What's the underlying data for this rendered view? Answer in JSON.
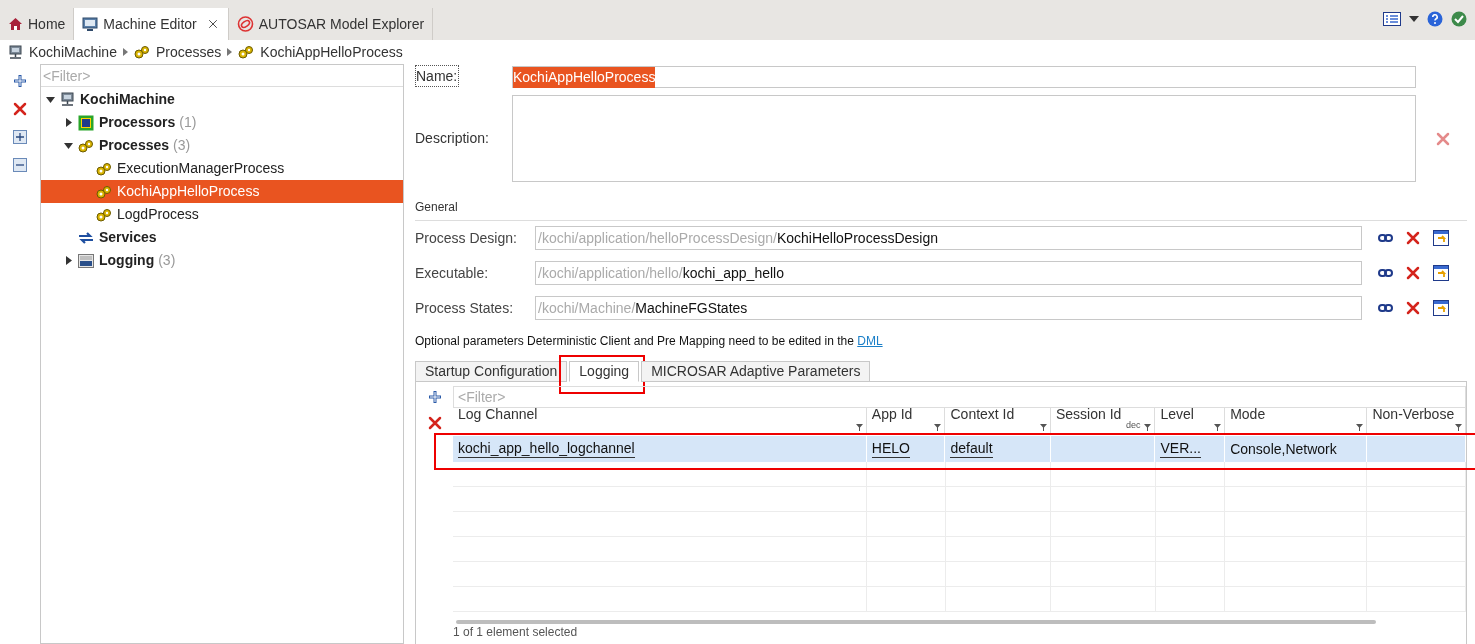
{
  "tabs": [
    {
      "label": "Home",
      "kind": "home",
      "selected": false,
      "closable": false
    },
    {
      "label": "Machine Editor",
      "kind": "editor",
      "selected": true,
      "closable": true
    },
    {
      "label": "AUTOSAR Model Explorer",
      "kind": "explorer",
      "selected": false,
      "closable": false
    }
  ],
  "breadcrumb": [
    {
      "label": "KochiMachine",
      "kind": "machine"
    },
    {
      "label": "Processes",
      "kind": "gears"
    },
    {
      "label": "KochiAppHelloProcess",
      "kind": "gears"
    }
  ],
  "tree": {
    "filter_placeholder": "<Filter>",
    "items": [
      {
        "label": "KochiMachine",
        "kind": "machine",
        "expanded": true,
        "selected": false,
        "children": [
          {
            "label": "Processors",
            "count": "(1)",
            "kind": "chip",
            "expanded": false,
            "selected": false
          },
          {
            "label": "Processes",
            "count": "(3)",
            "kind": "gears",
            "expanded": true,
            "selected": false,
            "children": [
              {
                "label": "ExecutionManagerProcess",
                "kind": "gears",
                "selected": false
              },
              {
                "label": "KochiAppHelloProcess",
                "kind": "gears",
                "selected": true
              },
              {
                "label": "LogdProcess",
                "kind": "gears",
                "selected": false
              }
            ]
          },
          {
            "label": "Services",
            "kind": "services",
            "selected": false
          },
          {
            "label": "Logging",
            "count": "(3)",
            "kind": "log",
            "expanded": false,
            "selected": false
          }
        ]
      }
    ]
  },
  "form": {
    "name_label": "Name:",
    "name_value": "KochiAppHelloProcess",
    "name_text_selected": true,
    "description_label": "Description:",
    "section": "General",
    "references": [
      {
        "label": "Process Design:",
        "path": "/kochi/application/helloProcessDesign/",
        "target": "KochiHelloProcessDesign"
      },
      {
        "label": "Executable:",
        "path": "/kochi/application/hello/",
        "target": "kochi_app_hello"
      },
      {
        "label": "Process States:",
        "path": "/kochi/Machine/",
        "target": "MachineFGStates"
      }
    ],
    "note": "Optional parameters Deterministic Client and Pre Mapping need to be edited in the",
    "note_link": "DML"
  },
  "sub_tabs": [
    {
      "label": "Startup Configuration",
      "selected": false,
      "annotated": false
    },
    {
      "label": "Logging",
      "selected": true,
      "annotated": true
    },
    {
      "label": "MICROSAR Adaptive Parameters",
      "selected": false,
      "annotated": false
    }
  ],
  "log_table": {
    "filter_placeholder": "<Filter>",
    "columns": [
      {
        "label": "Log Channel"
      },
      {
        "label": "App Id"
      },
      {
        "label": "Context Id"
      },
      {
        "label": "Session Id",
        "hint": "dec"
      },
      {
        "label": "Level"
      },
      {
        "label": "Mode"
      },
      {
        "label": "Non-Verbose"
      }
    ],
    "rows": [
      {
        "selected": true,
        "annotated": true,
        "cells": [
          {
            "text": "kochi_app_hello_logchannel",
            "kind": "reference"
          },
          {
            "text": "HELO",
            "kind": "reference"
          },
          {
            "text": "default",
            "kind": "reference"
          },
          {
            "text": "",
            "kind": "empty"
          },
          {
            "text": "VER...",
            "kind": "reference"
          },
          {
            "text": "Console,Network",
            "kind": "text"
          },
          {
            "text": "",
            "kind": "empty"
          }
        ]
      }
    ],
    "status": "1 of 1 element selected"
  }
}
